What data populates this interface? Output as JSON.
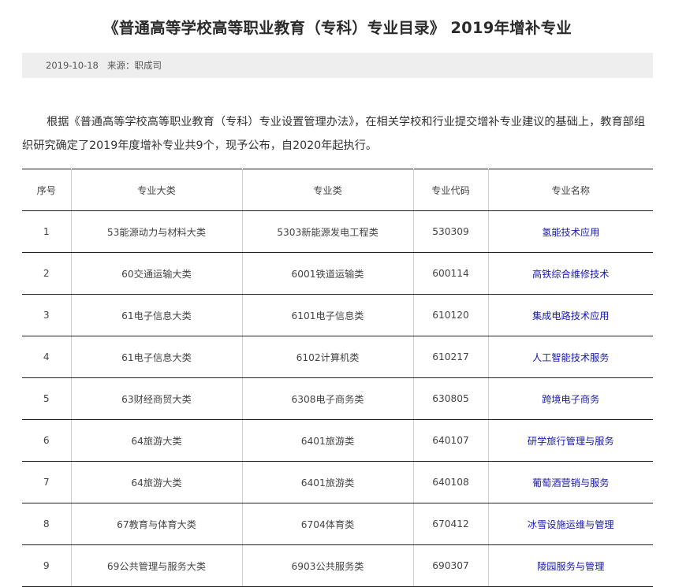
{
  "article": {
    "title": "《普通高等学校高等职业教育（专科）专业目录》 2019年增补专业",
    "date": "2019-10-18",
    "source": "来源：职成司",
    "intro": "根据《普通高等学校高等职业教育（专科）专业设置管理办法》，在相关学校和行业提交增补专业建议的基础上，教育部组织研究确定了2019年度增补专业共9个，现予公布，自2020年起执行。"
  },
  "table": {
    "headers": [
      "序号",
      "专业大类",
      "专业类",
      "专业代码",
      "专业名称"
    ],
    "rows": [
      [
        "1",
        "53能源动力与材料大类",
        "5303新能源发电工程类",
        "530309",
        "氢能技术应用"
      ],
      [
        "2",
        "60交通运输大类",
        "6001铁道运输类",
        "600114",
        "高铁综合维修技术"
      ],
      [
        "3",
        "61电子信息大类",
        "6101电子信息类",
        "610120",
        "集成电路技术应用"
      ],
      [
        "4",
        "61电子信息大类",
        "6102计算机类",
        "610217",
        "人工智能技术服务"
      ],
      [
        "5",
        "63财经商贸大类",
        "6308电子商务类",
        "630805",
        "跨境电子商务"
      ],
      [
        "6",
        "64旅游大类",
        "6401旅游类",
        "640107",
        "研学旅行管理与服务"
      ],
      [
        "7",
        "64旅游大类",
        "6401旅游类",
        "640108",
        "葡萄酒营销与服务"
      ],
      [
        "8",
        "67教育与体育大类",
        "6704体育类",
        "670412",
        "冰雪设施运维与管理"
      ],
      [
        "9",
        "69公共管理与服务大类",
        "6903公共服务类",
        "690307",
        "陵园服务与管理"
      ]
    ]
  },
  "colors": {
    "link": "#1a1aa6",
    "meta_background": "#eeeeee",
    "table_rule": "#222222"
  }
}
